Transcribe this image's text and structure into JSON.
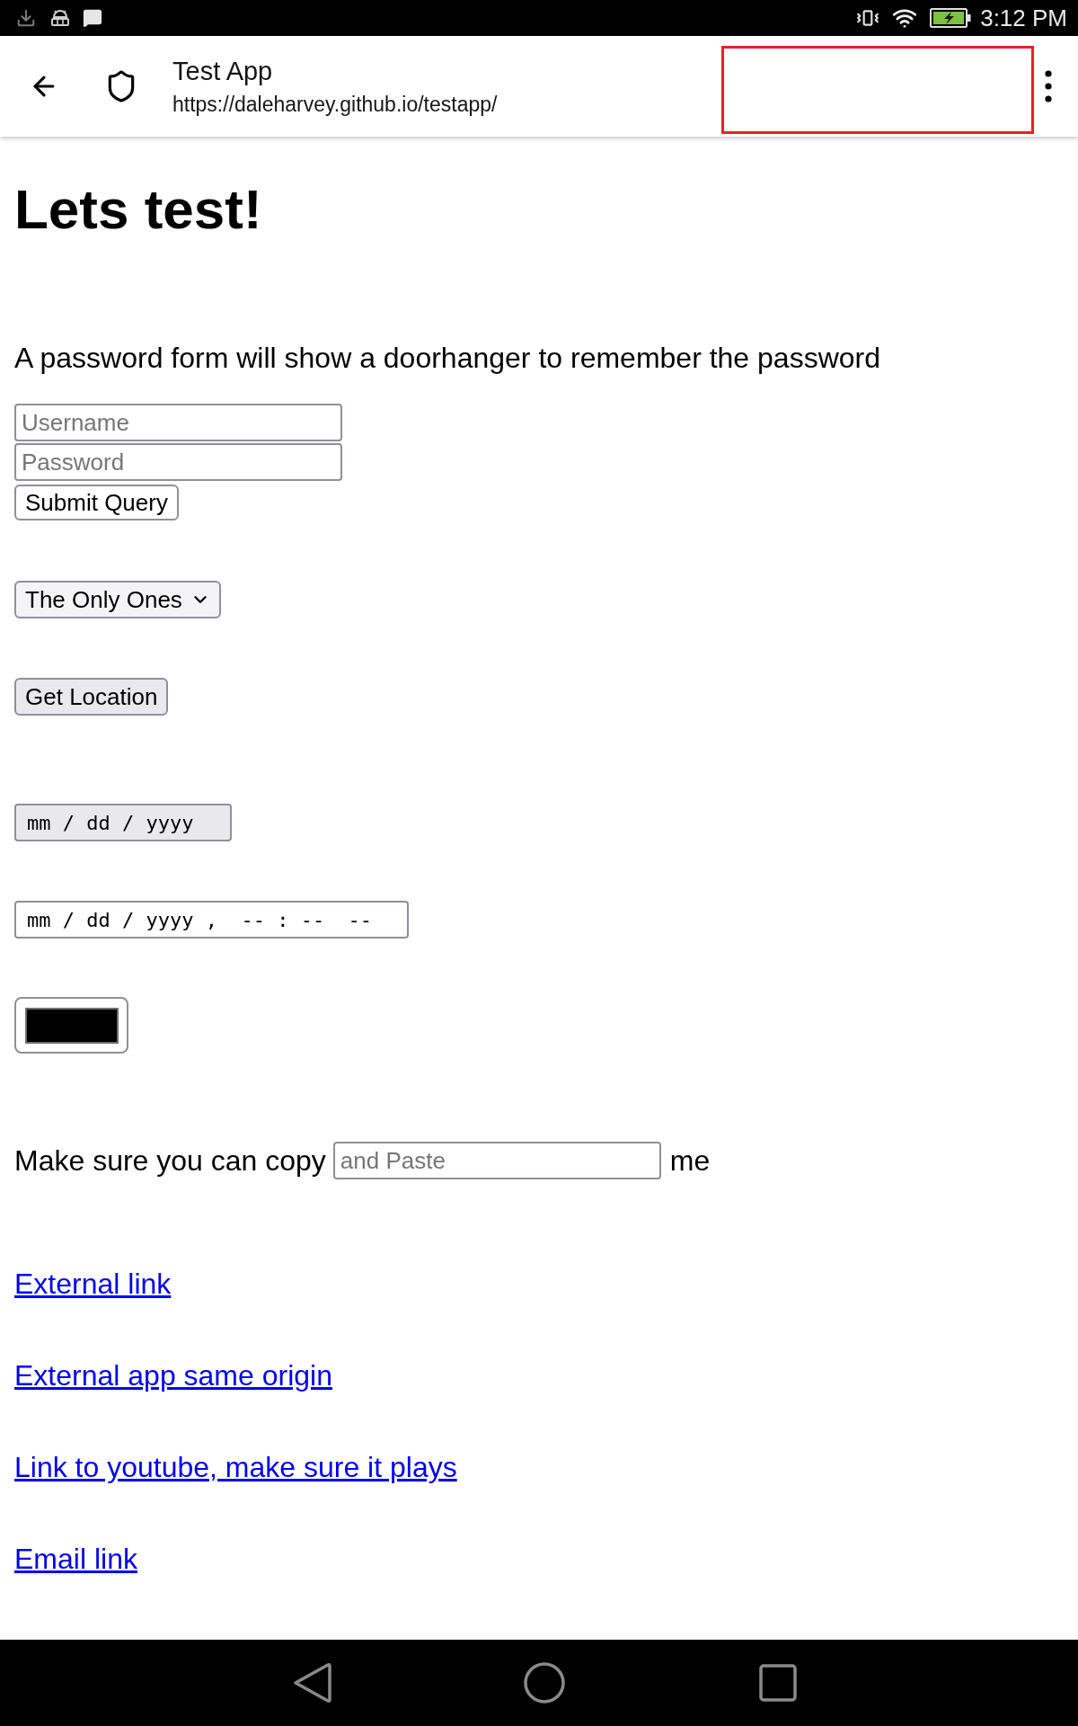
{
  "status_bar": {
    "time": "3:12 PM"
  },
  "toolbar": {
    "title": "Test App",
    "url": "https://daleharvey.github.io/testapp/"
  },
  "page": {
    "heading": "Lets test!",
    "intro": "A password form will show a doorhanger to remember the password",
    "login_form": {
      "username": {
        "placeholder": "Username"
      },
      "password": {
        "placeholder": "Password"
      },
      "submit_button": "Submit Query"
    },
    "select": {
      "value": "The Only Ones"
    },
    "location_button": "Get Location",
    "date_field": {
      "format": "mm / dd / yyyy"
    },
    "datetime_field": {
      "format": "mm / dd / yyyy ,  -- : --  --"
    },
    "color_input": {
      "color": "#000000"
    },
    "copy_row": {
      "before": "Make sure you can copy",
      "field": {
        "placeholder": "and Paste"
      },
      "after": "me"
    },
    "links": [
      "External link",
      "External app same origin",
      "Link to youtube, make sure it plays",
      "Email link"
    ]
  }
}
